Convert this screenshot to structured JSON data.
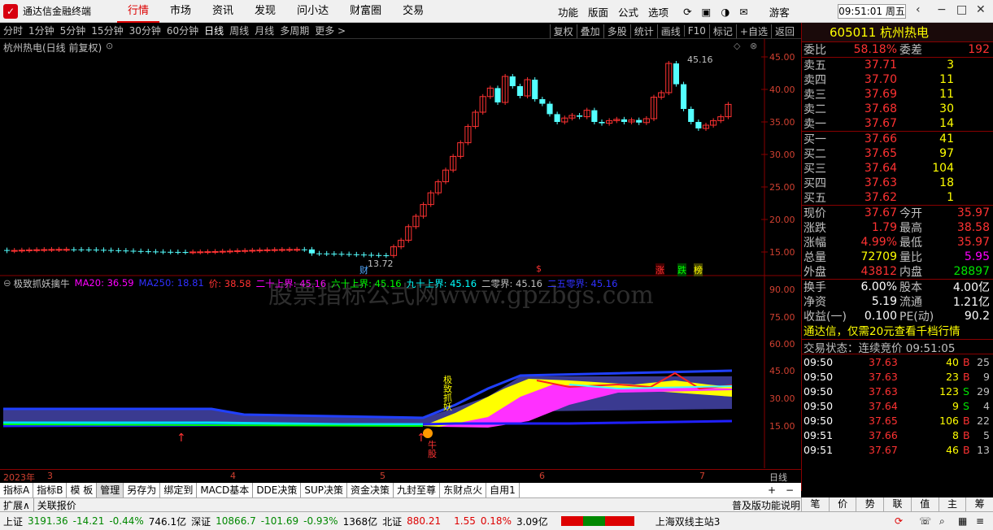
{
  "title_bar": {
    "app_name": "通达信金融终端",
    "menus": [
      "行情",
      "市场",
      "资讯",
      "发现",
      "问小达",
      "财富圈",
      "交易"
    ],
    "right_menus": [
      "功能",
      "版面",
      "公式",
      "选项"
    ],
    "user": "游客",
    "clock": "09:51:01 周五"
  },
  "toolbar": {
    "periods": [
      "分时",
      "1分钟",
      "5分钟",
      "15分钟",
      "30分钟",
      "60分钟",
      "日线",
      "周线",
      "月线",
      "多周期",
      "更多 >"
    ],
    "selected": "日线",
    "right": [
      "复权",
      "叠加",
      "多股",
      "统计",
      "画线",
      "F10",
      "标记",
      "+自选",
      "返回"
    ]
  },
  "main_chart": {
    "label": "杭州热电(日线 前复权)",
    "y_ticks": [
      "45.00",
      "40.00",
      "35.00",
      "30.00",
      "25.00",
      "20.00",
      "15.00"
    ],
    "high_label": "45.16",
    "low_label": "13.72",
    "markers": {
      "cai": "财",
      "s": "$",
      "zhang": "涨",
      "die": "跌",
      "bang": "榜"
    }
  },
  "indicator": {
    "name": "极致抓妖擒牛",
    "items": [
      {
        "text": "MA20: 36.59",
        "color": "#ff00ff"
      },
      {
        "text": "MA250: 18.81",
        "color": "#3030ff"
      },
      {
        "text": "价: 38.58",
        "color": "#ff3232"
      },
      {
        "text": "二十上界: 45.16",
        "color": "#ff00ff"
      },
      {
        "text": "六十上界: 45.16",
        "color": "#00ff00"
      },
      {
        "text": "九十上界: 45.16",
        "color": "#00ffff"
      },
      {
        "text": "二零界: 45.16",
        "color": "#c0c0c0"
      },
      {
        "text": "二五零界: 45.16",
        "color": "#3030ff"
      }
    ],
    "y_ticks": [
      "90.00",
      "75.00",
      "60.00",
      "45.00",
      "30.00",
      "15.00"
    ],
    "signal_top": "极致抓妖",
    "signal_bottom": "牛股"
  },
  "watermark": "股票指标公式网www.gpzbgs.com",
  "date_axis": {
    "labels": [
      "2023年",
      "3",
      "4",
      "5",
      "6",
      "7"
    ],
    "period": "日线"
  },
  "chart_data": {
    "type": "candlestick",
    "title": "杭州热电(日线 前复权)",
    "ylim": [
      13,
      46
    ],
    "high": 45.16,
    "low": 13.72,
    "last": 37.67
  },
  "bottom_tabs": [
    "指标A",
    "指标B",
    "模 板",
    "管理",
    "另存为",
    "绑定到",
    "MACD基本",
    "DDE决策",
    "SUP决策",
    "资金决策",
    "九封至尊",
    "东财点火",
    "自用1"
  ],
  "bottom_selected": "管理",
  "expand": {
    "label1": "扩展∧",
    "label2": "关联报价",
    "right": "普及版功能说明"
  },
  "right_tabs": [
    "笔",
    "价",
    "势",
    "联",
    "值",
    "主",
    "筹"
  ],
  "quote": {
    "code": "605011",
    "name": "杭州热电",
    "weibi": "58.18%",
    "weicha": "192",
    "asks": [
      {
        "label": "卖五",
        "price": "37.71",
        "vol": "3"
      },
      {
        "label": "卖四",
        "price": "37.70",
        "vol": "11"
      },
      {
        "label": "卖三",
        "price": "37.69",
        "vol": "11"
      },
      {
        "label": "卖二",
        "price": "37.68",
        "vol": "30"
      },
      {
        "label": "卖一",
        "price": "37.67",
        "vol": "14"
      }
    ],
    "bids": [
      {
        "label": "买一",
        "price": "37.66",
        "vol": "41"
      },
      {
        "label": "买二",
        "price": "37.65",
        "vol": "97"
      },
      {
        "label": "买三",
        "price": "37.64",
        "vol": "104"
      },
      {
        "label": "买四",
        "price": "37.63",
        "vol": "18"
      },
      {
        "label": "买五",
        "price": "37.62",
        "vol": "1"
      }
    ],
    "stats": [
      {
        "l1": "现价",
        "v1": "37.67",
        "c1": "red",
        "l2": "今开",
        "v2": "35.97",
        "c2": "red"
      },
      {
        "l1": "涨跌",
        "v1": "1.79",
        "c1": "red",
        "l2": "最高",
        "v2": "38.58",
        "c2": "red"
      },
      {
        "l1": "涨幅",
        "v1": "4.99%",
        "c1": "red",
        "l2": "最低",
        "v2": "35.97",
        "c2": "red"
      },
      {
        "l1": "总量",
        "v1": "72709",
        "c1": "yel",
        "l2": "量比",
        "v2": "5.95",
        "c2": "mag"
      },
      {
        "l1": "外盘",
        "v1": "43812",
        "c1": "red",
        "l2": "内盘",
        "v2": "28897",
        "c2": "grn"
      }
    ],
    "stats2": [
      {
        "l1": "换手",
        "v1": "6.00%",
        "l2": "股本",
        "v2": "4.00亿"
      },
      {
        "l1": "净资",
        "v1": "5.19",
        "l2": "流通",
        "v2": "1.21亿"
      },
      {
        "l1": "收益(一)",
        "v1": "0.100",
        "l2": "PE(动)",
        "v2": "90.2"
      }
    ],
    "ad": "通达信，仅需20元查看千档行情",
    "trade_state": "交易状态：连续竞价 09:51:05",
    "ticks": [
      {
        "t": "09:50",
        "p": "37.63",
        "v": "40",
        "d": "B",
        "n": "25"
      },
      {
        "t": "09:50",
        "p": "37.63",
        "v": "23",
        "d": "B",
        "n": "9"
      },
      {
        "t": "09:50",
        "p": "37.63",
        "v": "123",
        "d": "S",
        "n": "29"
      },
      {
        "t": "09:50",
        "p": "37.64",
        "v": "9",
        "d": "S",
        "n": "4"
      },
      {
        "t": "09:50",
        "p": "37.65",
        "v": "106",
        "d": "B",
        "n": "22"
      },
      {
        "t": "09:51",
        "p": "37.66",
        "v": "8",
        "d": "B",
        "n": "5"
      },
      {
        "t": "09:51",
        "p": "37.67",
        "v": "46",
        "d": "B",
        "n": "13"
      }
    ]
  },
  "status": {
    "sh": "上证",
    "sh_v": "3191.36",
    "sh_c": "-14.21",
    "sh_p": "-0.44%",
    "sh_a": "746.1亿",
    "sz": "深证",
    "sz_v": "10866.7",
    "sz_c": "-101.69",
    "sz_p": "-0.93%",
    "sz_a": "1368亿",
    "bz": "北证",
    "bz_v": "880.21",
    "bz_c": "1.55",
    "bz_p": "0.18%",
    "bz_a": "3.09亿",
    "server": "上海双线主站3"
  }
}
